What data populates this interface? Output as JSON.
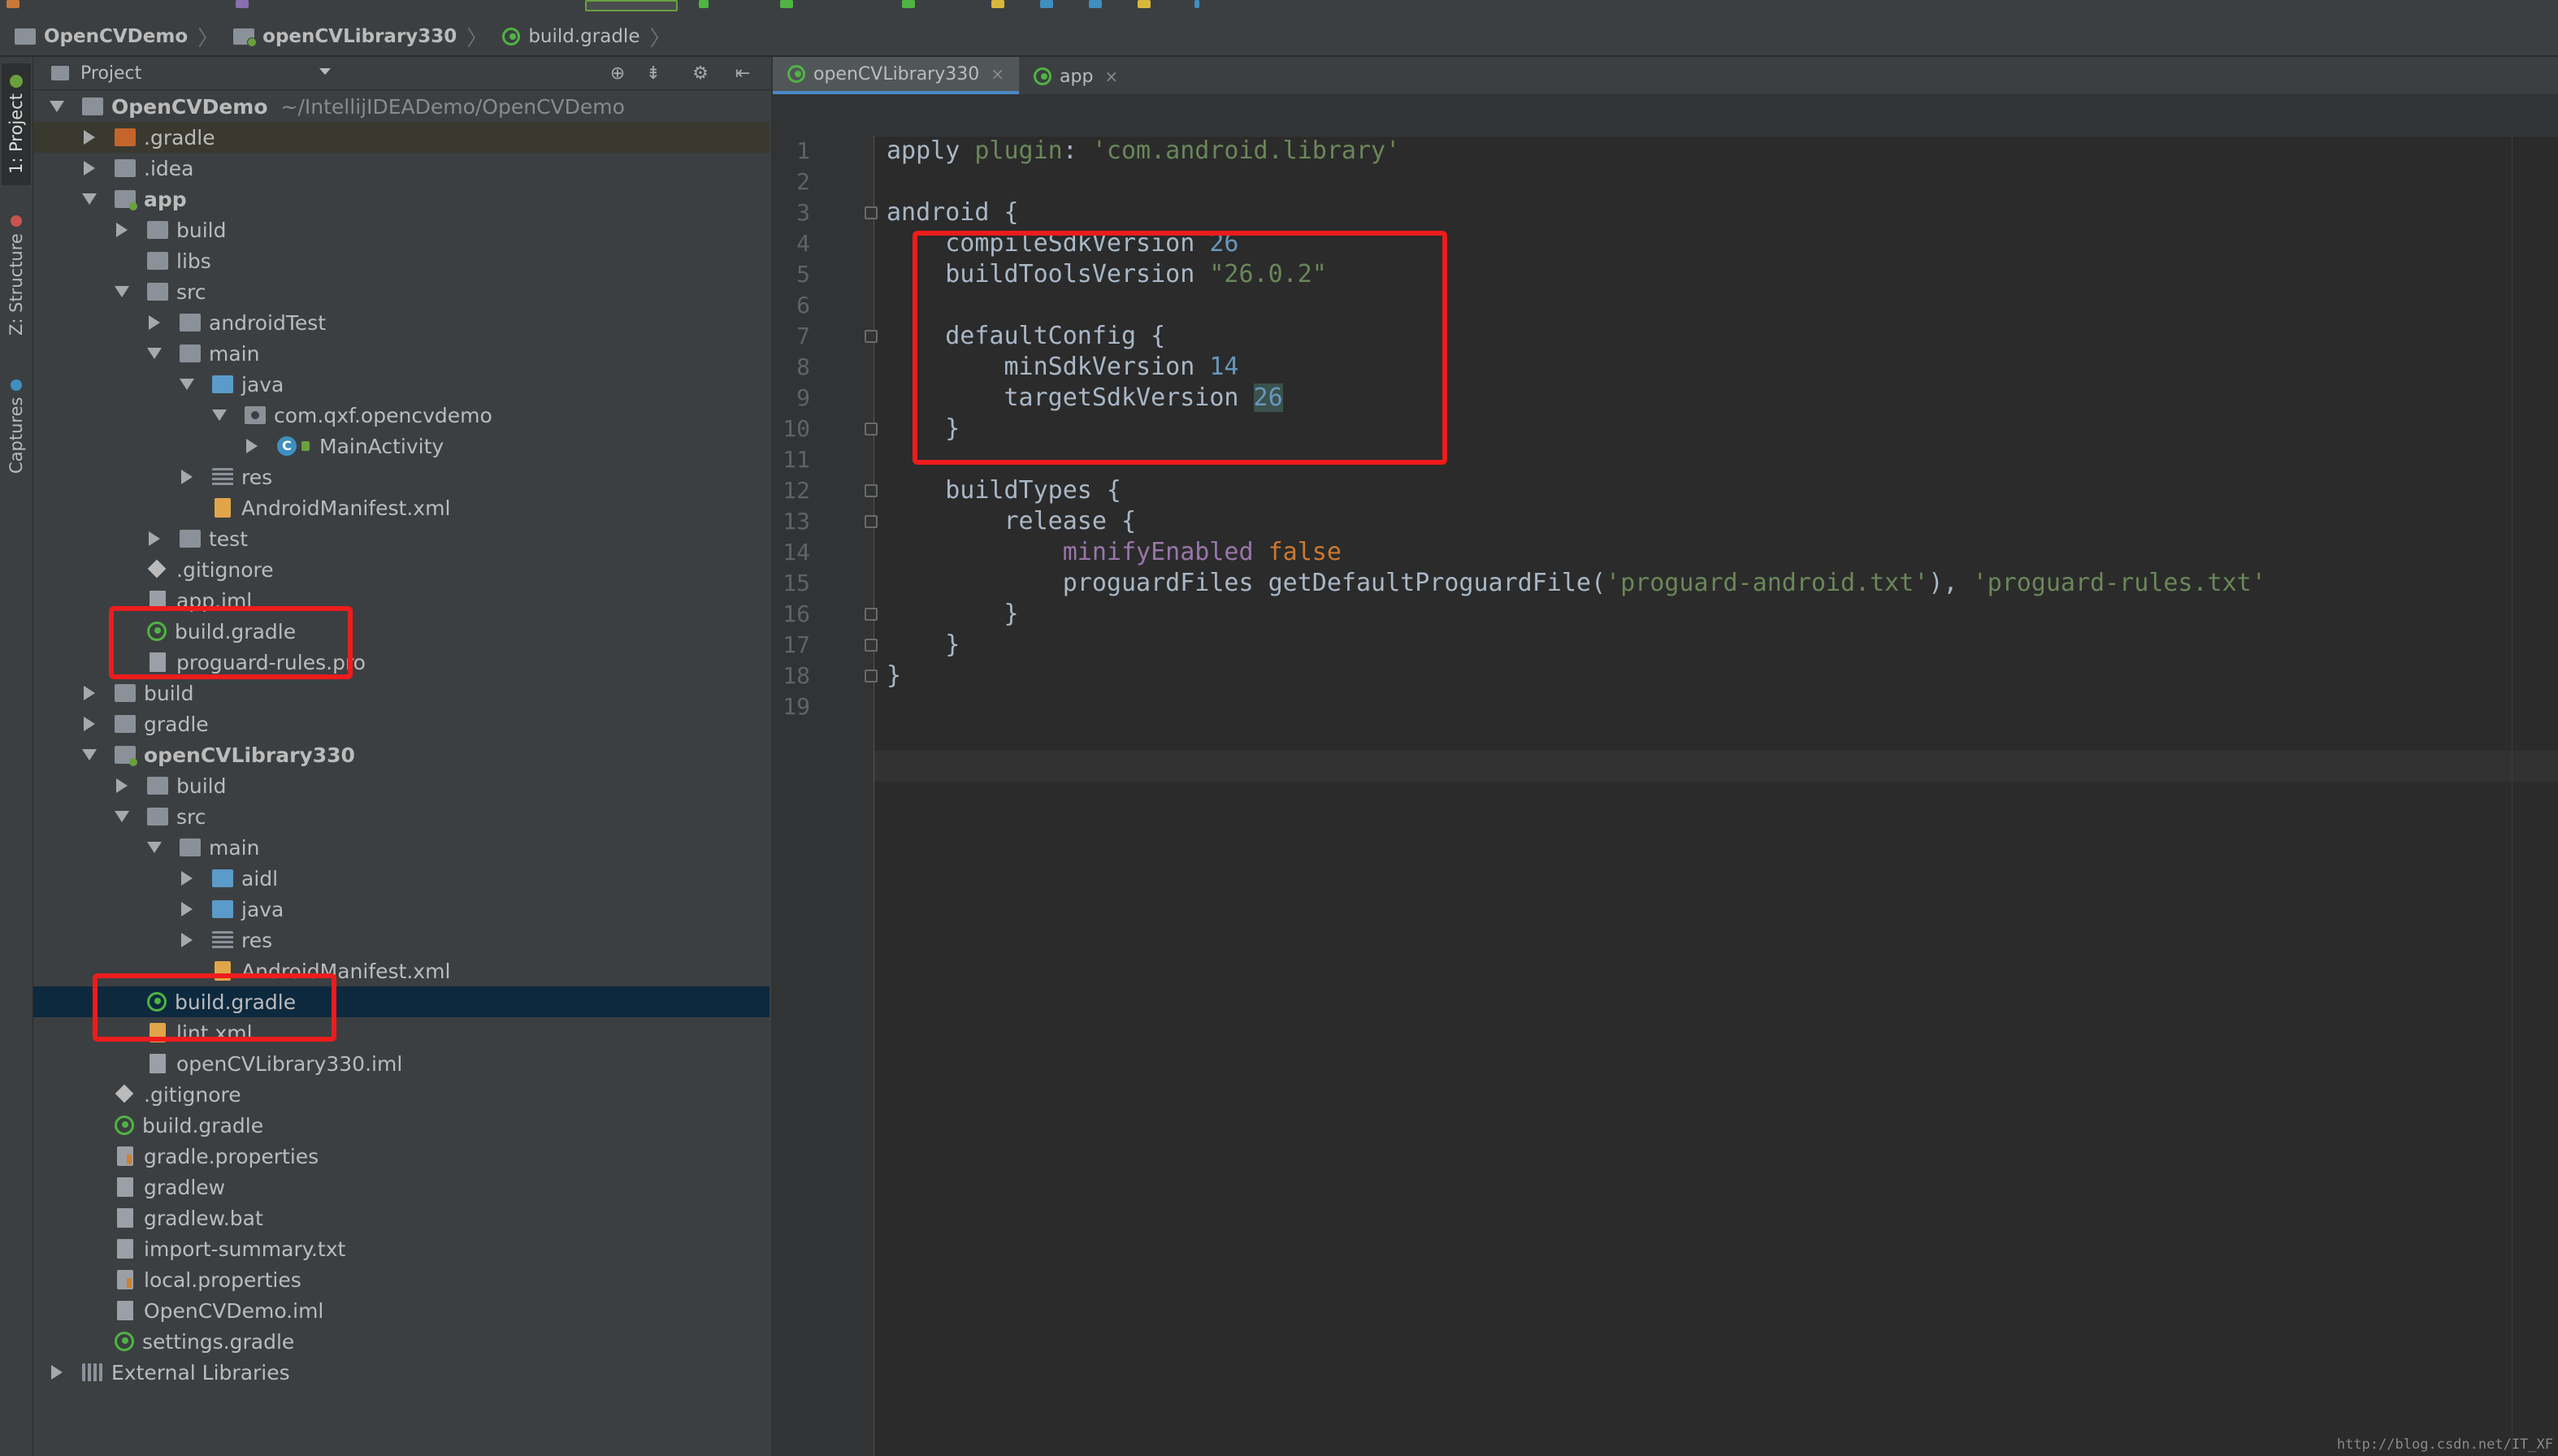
{
  "breadcrumbs": [
    {
      "label": "OpenCVDemo",
      "icon": "folder-icon"
    },
    {
      "label": "openCVLibrary330",
      "icon": "module-folder-icon"
    },
    {
      "label": "build.gradle",
      "icon": "gradle-file-icon"
    }
  ],
  "sidebar_tabs": [
    "1: Project",
    "Z: Structure",
    "Captures"
  ],
  "project_panel": {
    "title": "Project",
    "tree": [
      {
        "label": "OpenCVDemo",
        "path": "~/IntellijIDEADemo/OpenCVDemo",
        "bold": true,
        "depth": 0,
        "expander": "down",
        "icon": "folder-icon"
      },
      {
        "label": ".gradle",
        "depth": 1,
        "expander": "right",
        "icon": "orange-folder-icon",
        "highlight": true
      },
      {
        "label": ".idea",
        "depth": 1,
        "expander": "right",
        "icon": "folder-icon"
      },
      {
        "label": "app",
        "bold": true,
        "depth": 1,
        "expander": "down",
        "icon": "module-folder-icon"
      },
      {
        "label": "build",
        "depth": 2,
        "expander": "right",
        "icon": "folder-icon"
      },
      {
        "label": "libs",
        "depth": 2,
        "expander": "none",
        "icon": "folder-icon"
      },
      {
        "label": "src",
        "depth": 2,
        "expander": "down",
        "icon": "folder-icon"
      },
      {
        "label": "androidTest",
        "depth": 3,
        "expander": "right",
        "icon": "folder-icon"
      },
      {
        "label": "main",
        "depth": 3,
        "expander": "down",
        "icon": "folder-icon"
      },
      {
        "label": "java",
        "depth": 4,
        "expander": "down",
        "icon": "blue-folder-icon"
      },
      {
        "label": "com.qxf.opencvdemo",
        "depth": 5,
        "expander": "down",
        "icon": "package-icon"
      },
      {
        "label": "MainActivity",
        "depth": 6,
        "expander": "right",
        "icon": "class-icon"
      },
      {
        "label": "res",
        "depth": 4,
        "expander": "right",
        "icon": "resource-folder-icon"
      },
      {
        "label": "AndroidManifest.xml",
        "depth": 4,
        "expander": "none",
        "icon": "xml-file-icon"
      },
      {
        "label": "test",
        "depth": 3,
        "expander": "right",
        "icon": "folder-icon"
      },
      {
        "label": ".gitignore",
        "depth": 2,
        "expander": "none",
        "icon": "git-icon"
      },
      {
        "label": "app.iml",
        "depth": 2,
        "expander": "none",
        "icon": "file-icon"
      },
      {
        "label": "build.gradle",
        "depth": 2,
        "expander": "none",
        "icon": "gradle-file-icon"
      },
      {
        "label": "proguard-rules.pro",
        "depth": 2,
        "expander": "none",
        "icon": "file-icon"
      },
      {
        "label": "build",
        "depth": 1,
        "expander": "right",
        "icon": "folder-icon"
      },
      {
        "label": "gradle",
        "depth": 1,
        "expander": "right",
        "icon": "folder-icon"
      },
      {
        "label": "openCVLibrary330",
        "bold": true,
        "depth": 1,
        "expander": "down",
        "icon": "module-folder-icon"
      },
      {
        "label": "build",
        "depth": 2,
        "expander": "right",
        "icon": "folder-icon"
      },
      {
        "label": "src",
        "depth": 2,
        "expander": "down",
        "icon": "folder-icon"
      },
      {
        "label": "main",
        "depth": 3,
        "expander": "down",
        "icon": "folder-icon"
      },
      {
        "label": "aidl",
        "depth": 4,
        "expander": "right",
        "icon": "blue-folder-icon"
      },
      {
        "label": "java",
        "depth": 4,
        "expander": "right",
        "icon": "blue-folder-icon"
      },
      {
        "label": "res",
        "depth": 4,
        "expander": "right",
        "icon": "resource-folder-icon"
      },
      {
        "label": "AndroidManifest.xml",
        "depth": 4,
        "expander": "none",
        "icon": "xml-file-icon"
      },
      {
        "label": "build.gradle",
        "depth": 2,
        "expander": "none",
        "icon": "gradle-file-icon",
        "selected": true
      },
      {
        "label": "lint.xml",
        "depth": 2,
        "expander": "none",
        "icon": "xml-file-icon"
      },
      {
        "label": "openCVLibrary330.iml",
        "depth": 2,
        "expander": "none",
        "icon": "file-icon"
      },
      {
        "label": ".gitignore",
        "depth": 1,
        "expander": "none",
        "icon": "git-icon"
      },
      {
        "label": "build.gradle",
        "depth": 1,
        "expander": "none",
        "icon": "gradle-file-icon"
      },
      {
        "label": "gradle.properties",
        "depth": 1,
        "expander": "none",
        "icon": "properties-file-icon"
      },
      {
        "label": "gradlew",
        "depth": 1,
        "expander": "none",
        "icon": "file-icon"
      },
      {
        "label": "gradlew.bat",
        "depth": 1,
        "expander": "none",
        "icon": "file-icon"
      },
      {
        "label": "import-summary.txt",
        "depth": 1,
        "expander": "none",
        "icon": "file-icon"
      },
      {
        "label": "local.properties",
        "depth": 1,
        "expander": "none",
        "icon": "properties-file-icon"
      },
      {
        "label": "OpenCVDemo.iml",
        "depth": 1,
        "expander": "none",
        "icon": "file-icon"
      },
      {
        "label": "settings.gradle",
        "depth": 1,
        "expander": "none",
        "icon": "gradle-file-icon"
      },
      {
        "label": "External Libraries",
        "depth": 0,
        "expander": "right",
        "icon": "library-icon"
      }
    ]
  },
  "editor_tabs": [
    {
      "label": "openCVLibrary330",
      "active": true,
      "close": "×"
    },
    {
      "label": "app",
      "active": false,
      "close": "×"
    }
  ],
  "code_lines": [
    [
      {
        "t": "apply ",
        "c": "plain"
      },
      {
        "t": "plugin",
        "c": "str"
      },
      {
        "t": ": ",
        "c": "plain"
      },
      {
        "t": "'com.android.library'",
        "c": "str"
      }
    ],
    [],
    [
      {
        "t": "android {",
        "c": "plain"
      }
    ],
    [
      {
        "t": "    compileSdkVersion ",
        "c": "plain"
      },
      {
        "t": "26",
        "c": "num"
      }
    ],
    [
      {
        "t": "    buildToolsVersion ",
        "c": "plain"
      },
      {
        "t": "\"26.0.2\"",
        "c": "str"
      }
    ],
    [],
    [
      {
        "t": "    defaultConfig {",
        "c": "plain"
      }
    ],
    [
      {
        "t": "        minSdkVersion ",
        "c": "plain"
      },
      {
        "t": "14",
        "c": "num"
      }
    ],
    [
      {
        "t": "        targetSdkVersion ",
        "c": "plain"
      },
      {
        "t": "26",
        "c": "numhl"
      }
    ],
    [
      {
        "t": "    }",
        "c": "plain"
      }
    ],
    [],
    [
      {
        "t": "    buildTypes {",
        "c": "plain"
      }
    ],
    [
      {
        "t": "        release {",
        "c": "plain"
      }
    ],
    [
      {
        "t": "            ",
        "c": "plain"
      },
      {
        "t": "minifyEnabled ",
        "c": "prop"
      },
      {
        "t": "false",
        "c": "kw"
      }
    ],
    [
      {
        "t": "            proguardFiles getDefaultProguardFile(",
        "c": "plain"
      },
      {
        "t": "'proguard-android.txt'",
        "c": "str"
      },
      {
        "t": "), ",
        "c": "plain"
      },
      {
        "t": "'proguard-rules.txt'",
        "c": "str"
      }
    ],
    [
      {
        "t": "        }",
        "c": "plain"
      }
    ],
    [
      {
        "t": "    }",
        "c": "plain"
      }
    ],
    [
      {
        "t": "}",
        "c": "plain"
      }
    ],
    []
  ],
  "line_numbers": [
    "1",
    "2",
    "3",
    "4",
    "5",
    "6",
    "7",
    "8",
    "9",
    "10",
    "11",
    "12",
    "13",
    "14",
    "15",
    "16",
    "17",
    "18",
    "19"
  ],
  "watermark": "http://blog.csdn.net/IT_XF",
  "colors": {
    "annotation_box": "#ee1c1c",
    "selection": "#0d293e",
    "gradle_icon": "#4fb443"
  }
}
